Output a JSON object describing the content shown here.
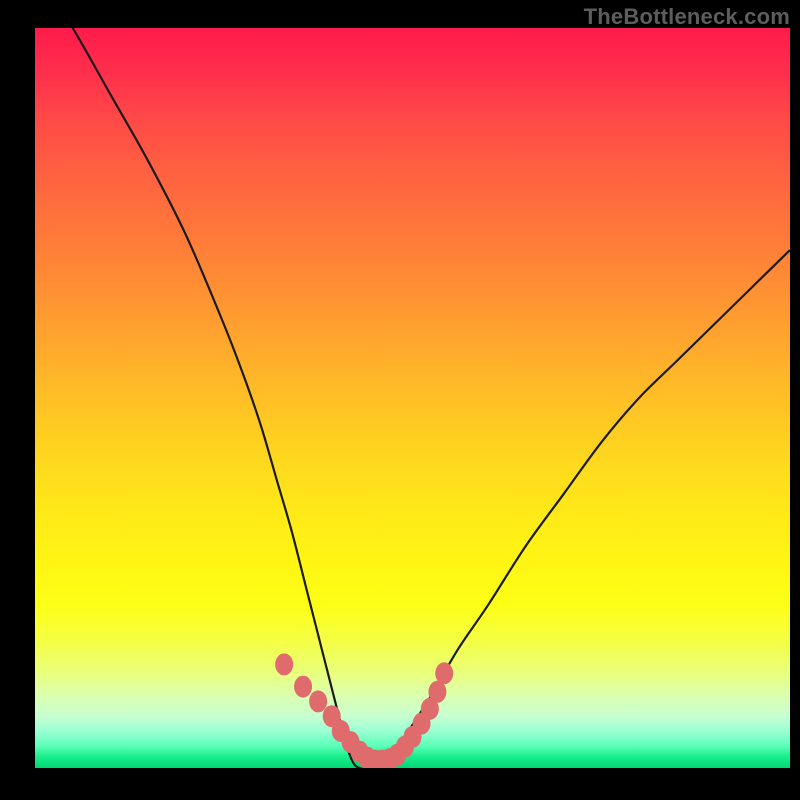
{
  "watermark": {
    "text": "TheBottleneck.com"
  },
  "colors": {
    "page_bg": "#000000",
    "curve_stroke": "#1b1b1b",
    "marker_fill": "#e06b6d",
    "watermark": "#5d5d5d"
  },
  "chart_data": {
    "type": "line",
    "title": "",
    "xlabel": "",
    "ylabel": "",
    "xlim": [
      0,
      100
    ],
    "ylim": [
      0,
      100
    ],
    "grid": false,
    "legend": false,
    "series": [
      {
        "name": "bottleneck-curve",
        "x": [
          0,
          5,
          10,
          15,
          20,
          25,
          28,
          30,
          32,
          34,
          36,
          38,
          40,
          41,
          42,
          43,
          45,
          48,
          52,
          56,
          60,
          65,
          70,
          75,
          80,
          85,
          90,
          95,
          100
        ],
        "values": [
          108,
          100,
          91,
          82,
          72,
          60,
          52,
          46,
          39,
          32,
          24,
          16,
          8,
          4,
          1,
          0,
          0,
          3,
          9,
          16,
          22,
          30,
          37,
          44,
          50,
          55,
          60,
          65,
          70
        ]
      }
    ],
    "markers": {
      "name": "highlight-dots",
      "x": [
        33,
        35.5,
        37.5,
        39.3,
        40.5,
        41.8,
        43,
        44,
        45,
        46,
        47,
        48,
        49,
        50,
        51.2,
        52.3,
        53.3,
        54.2
      ],
      "values": [
        14,
        11,
        9,
        7,
        5,
        3.5,
        2.2,
        1.4,
        1,
        1,
        1.2,
        1.8,
        2.9,
        4.2,
        6,
        8,
        10.3,
        12.8
      ]
    }
  }
}
